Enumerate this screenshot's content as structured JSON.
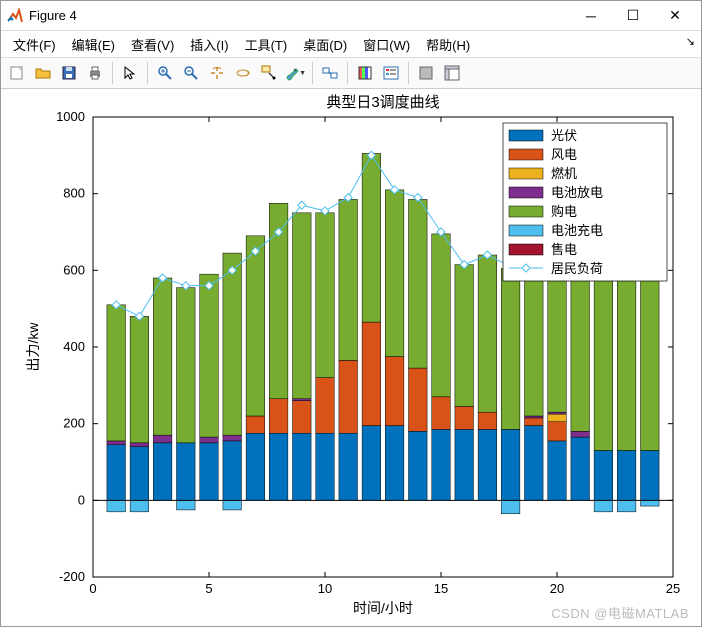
{
  "window": {
    "title": "Figure 4",
    "min_tooltip": "Minimize",
    "max_tooltip": "Maximize",
    "close_tooltip": "Close"
  },
  "menu": {
    "file": "文件(F)",
    "edit": "编辑(E)",
    "view": "查看(V)",
    "insert": "插入(I)",
    "tools": "工具(T)",
    "desktop": "桌面(D)",
    "window": "窗口(W)",
    "help": "帮助(H)"
  },
  "toolbar_names": {
    "new": "new-figure-icon",
    "open": "open-icon",
    "save": "save-icon",
    "print": "print-icon",
    "pointer": "pointer-icon",
    "zoomin": "zoom-in-icon",
    "zoomout": "zoom-out-icon",
    "pan": "pan-icon",
    "rotate": "rotate-3d-icon",
    "datatip": "data-cursor-icon",
    "brush": "brush-icon",
    "link": "link-icon",
    "colorbar": "colorbar-icon",
    "legend": "legend-icon",
    "hide": "hide-plot-tools-icon",
    "show": "show-plot-tools-icon"
  },
  "watermark": "CSDN @电磁MATLAB",
  "chart_data": {
    "type": "bar",
    "title": "典型日3调度曲线",
    "xlabel": "时间/小时",
    "ylabel": "出力/kw",
    "xlim": [
      0,
      25
    ],
    "ylim": [
      -200,
      1000
    ],
    "xticks": [
      0,
      5,
      10,
      15,
      20,
      25
    ],
    "yticks": [
      -200,
      0,
      200,
      400,
      600,
      800,
      1000
    ],
    "categories": [
      1,
      2,
      3,
      4,
      5,
      6,
      7,
      8,
      9,
      10,
      11,
      12,
      13,
      14,
      15,
      16,
      17,
      18,
      19,
      20,
      21,
      22,
      23,
      24
    ],
    "series": [
      {
        "name": "光伏",
        "color": "#0072BD",
        "values": [
          145,
          140,
          150,
          150,
          150,
          155,
          175,
          175,
          175,
          175,
          175,
          195,
          195,
          180,
          185,
          185,
          185,
          185,
          195,
          155,
          165,
          130,
          130,
          130
        ]
      },
      {
        "name": "风电",
        "color": "#D95319",
        "values": [
          0,
          0,
          0,
          0,
          0,
          0,
          45,
          90,
          85,
          145,
          190,
          270,
          180,
          165,
          85,
          60,
          45,
          0,
          20,
          50,
          0,
          0,
          0,
          0
        ]
      },
      {
        "name": "燃机",
        "color": "#EDB120",
        "values": [
          0,
          0,
          0,
          0,
          0,
          0,
          0,
          0,
          0,
          0,
          0,
          0,
          0,
          0,
          0,
          0,
          0,
          0,
          0,
          20,
          0,
          0,
          0,
          0
        ]
      },
      {
        "name": "电池放电",
        "color": "#7E2F8E",
        "values": [
          10,
          10,
          20,
          0,
          15,
          15,
          0,
          0,
          5,
          0,
          0,
          0,
          0,
          0,
          0,
          0,
          0,
          0,
          5,
          5,
          15,
          0,
          0,
          0
        ]
      },
      {
        "name": "购电",
        "color": "#77AC30",
        "values": [
          355,
          330,
          410,
          405,
          425,
          475,
          470,
          510,
          485,
          430,
          420,
          440,
          435,
          440,
          425,
          370,
          410,
          420,
          440,
          420,
          460,
          490,
          470,
          490
        ]
      },
      {
        "name": "电池充电",
        "color": "#4DBEEE",
        "values": [
          -30,
          -30,
          0,
          -25,
          0,
          -25,
          0,
          0,
          0,
          0,
          0,
          0,
          0,
          0,
          0,
          0,
          0,
          -35,
          0,
          0,
          0,
          -30,
          -30,
          -15
        ]
      },
      {
        "name": "售电",
        "color": "#A2142F",
        "values": [
          0,
          0,
          0,
          0,
          0,
          0,
          0,
          0,
          0,
          0,
          0,
          0,
          0,
          0,
          0,
          0,
          0,
          0,
          0,
          0,
          0,
          0,
          0,
          0
        ]
      }
    ],
    "line_series": {
      "name": "居民负荷",
      "color": "#4DBEEE",
      "marker": "diamond",
      "values": [
        510,
        480,
        580,
        560,
        560,
        600,
        650,
        700,
        770,
        755,
        790,
        900,
        810,
        790,
        700,
        615,
        640,
        610,
        650,
        660,
        640,
        600,
        600,
        620
      ]
    }
  }
}
